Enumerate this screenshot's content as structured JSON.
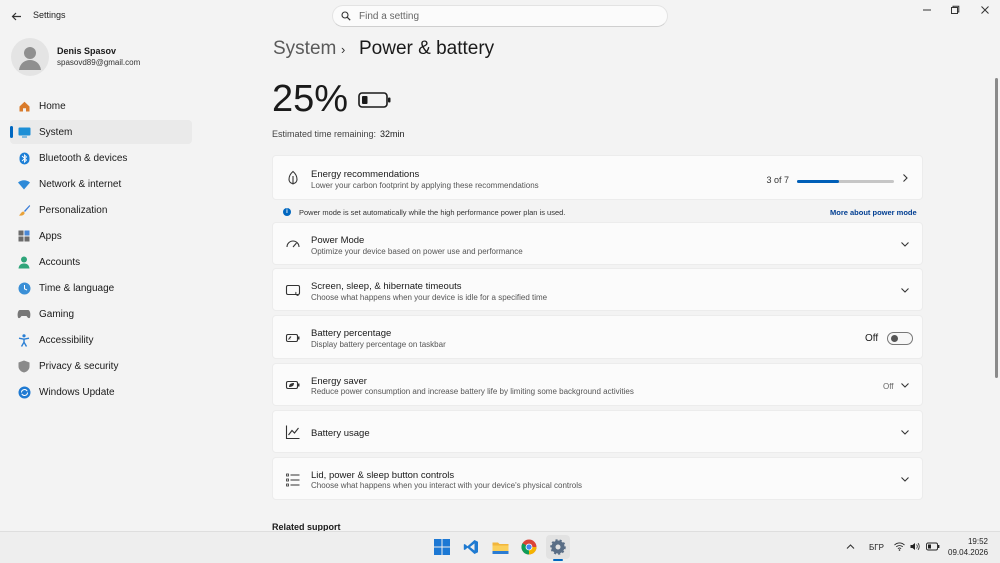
{
  "window": {
    "title": "Settings",
    "search_placeholder": "Find a setting"
  },
  "user": {
    "name": "Denis Spasov",
    "email": "spasovd89@gmail.com"
  },
  "sidebar": {
    "items": [
      {
        "label": "Home",
        "icon": "home-icon"
      },
      {
        "label": "System",
        "icon": "system-icon",
        "selected": true
      },
      {
        "label": "Bluetooth & devices",
        "icon": "bluetooth-icon"
      },
      {
        "label": "Network & internet",
        "icon": "wifi-icon"
      },
      {
        "label": "Personalization",
        "icon": "brush-icon"
      },
      {
        "label": "Apps",
        "icon": "apps-icon"
      },
      {
        "label": "Accounts",
        "icon": "accounts-icon"
      },
      {
        "label": "Time & language",
        "icon": "globe-clock-icon"
      },
      {
        "label": "Gaming",
        "icon": "gamepad-icon"
      },
      {
        "label": "Accessibility",
        "icon": "accessibility-icon"
      },
      {
        "label": "Privacy & security",
        "icon": "shield-icon"
      },
      {
        "label": "Windows Update",
        "icon": "update-icon"
      }
    ]
  },
  "breadcrumb": {
    "parent": "System",
    "separator": "›",
    "current": "Power & battery"
  },
  "battery": {
    "percent_text": "25%",
    "level": 0.25,
    "estimate_label": "Estimated time remaining:",
    "estimate_value": "32min"
  },
  "energy": {
    "title": "Energy recommendations",
    "subtitle": "Lower your carbon footprint by applying these recommendations",
    "progress_text": "3 of 7",
    "progress": 0.43
  },
  "info": {
    "text": "Power mode is set automatically while the high performance power plan is used.",
    "link": "More about power mode"
  },
  "settings": {
    "power_mode": {
      "title": "Power Mode",
      "subtitle": "Optimize your device based on power use and performance"
    },
    "timeouts": {
      "title": "Screen, sleep, & hibernate timeouts",
      "subtitle": "Choose what happens when your device is idle for a specified time"
    },
    "battery_percentage": {
      "title": "Battery percentage",
      "subtitle": "Display battery percentage on taskbar",
      "state": "Off"
    },
    "energy_saver": {
      "title": "Energy saver",
      "subtitle": "Reduce power consumption and increase battery life by limiting some background activities",
      "state": "Off"
    },
    "battery_usage": {
      "title": "Battery usage"
    },
    "lid_power": {
      "title": "Lid, power & sleep button controls",
      "subtitle": "Choose what happens when you interact with your device's physical controls"
    }
  },
  "related_support": "Related support",
  "taskbar": {
    "apps": [
      "windows-start-icon",
      "vscode-icon",
      "file-explorer-icon",
      "chrome-icon",
      "settings-gear-icon"
    ],
    "language": "БГР",
    "time": "19:52",
    "date": "09.04.2026"
  },
  "colors": {
    "accent": "#0067c0",
    "background": "#f3f3f3",
    "card": "#fbfbfb"
  }
}
